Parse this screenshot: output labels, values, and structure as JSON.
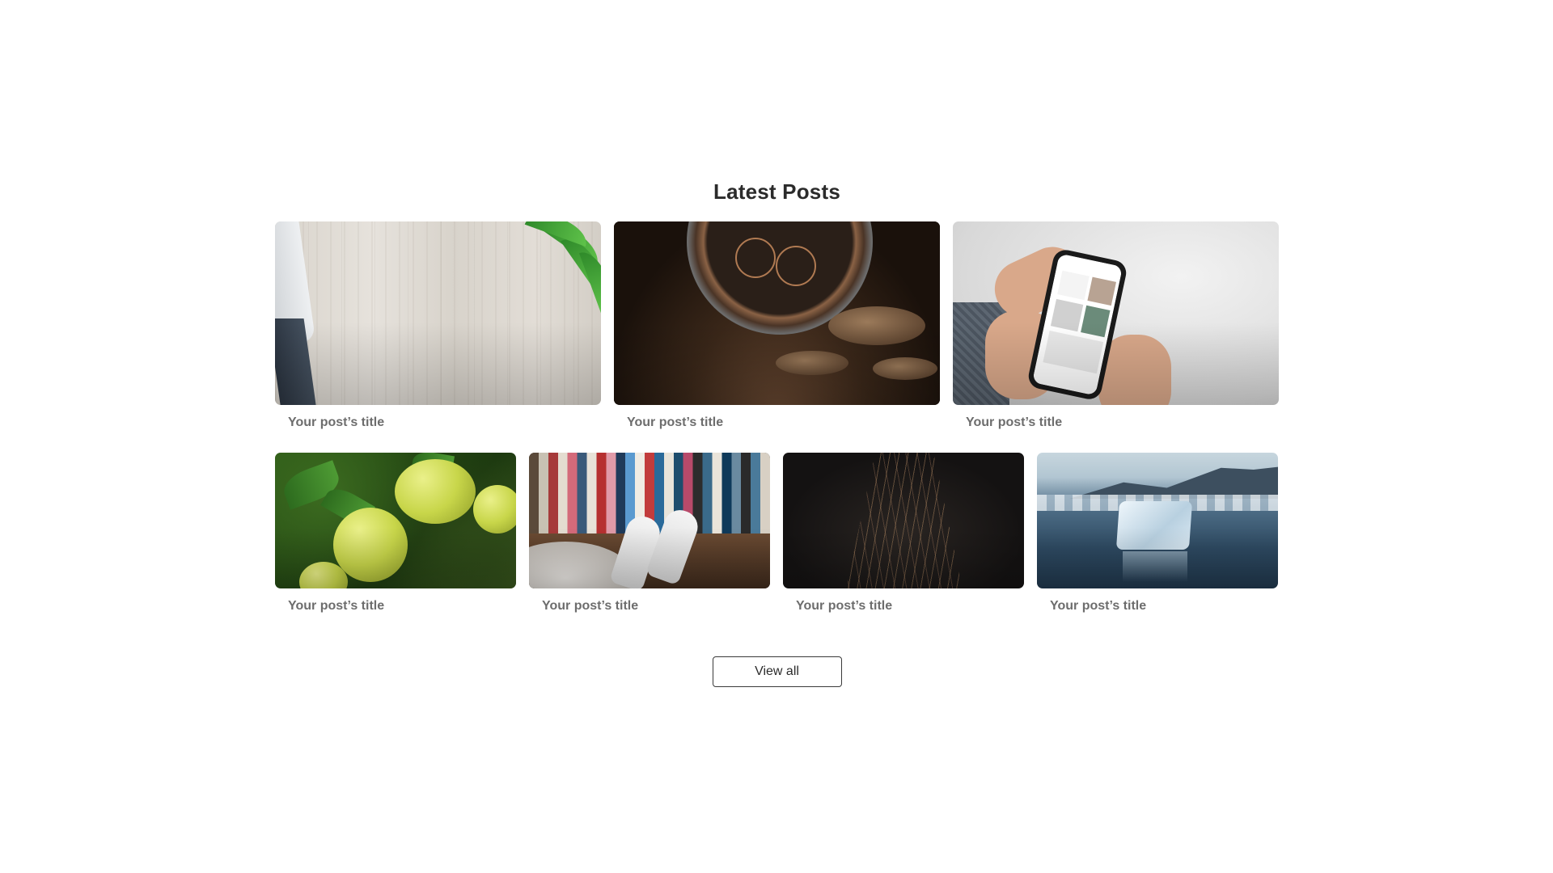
{
  "section": {
    "title": "Latest Posts"
  },
  "posts_top": [
    {
      "title": "Your post’s title",
      "image": "cutting-board-image"
    },
    {
      "title": "Your post’s title",
      "image": "watch-image"
    },
    {
      "title": "Your post’s title",
      "image": "phone-image"
    }
  ],
  "posts_bottom": [
    {
      "title": "Your post’s title",
      "image": "citrus-image"
    },
    {
      "title": "Your post’s title",
      "image": "books-image"
    },
    {
      "title": "Your post’s title",
      "image": "sparks-image"
    },
    {
      "title": "Your post’s title",
      "image": "ice-image"
    }
  ],
  "view_all": {
    "label": "View all"
  },
  "colors": {
    "background": "#ffffff",
    "heading": "#2b2b2b",
    "post_title": "#6d6d6d",
    "button_border": "#3a3a3a"
  }
}
